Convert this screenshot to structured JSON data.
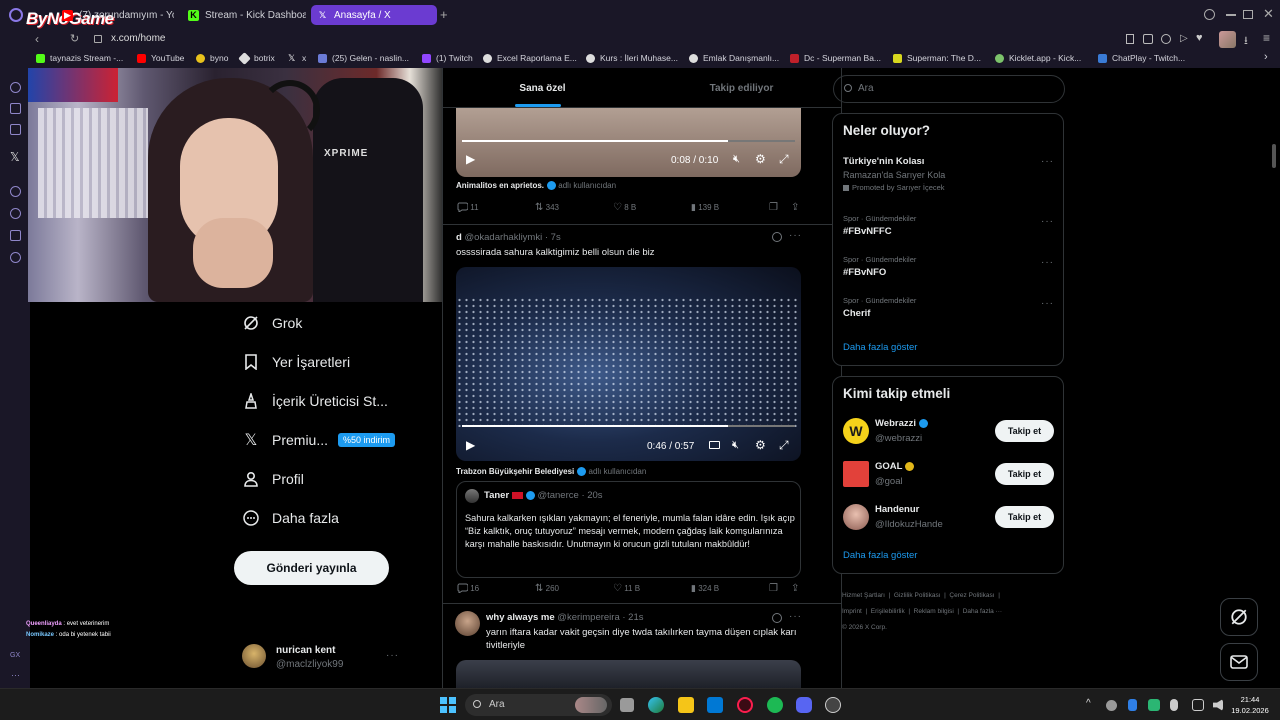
{
  "browser": {
    "logo_text": "ByNoGame",
    "tabs": [
      {
        "label": "(7) zorundamıyım - YouTube"
      },
      {
        "label": "Stream - Kick Dashboard"
      },
      {
        "label": "Anasayfa / X"
      }
    ],
    "new_tab": "+",
    "url": "x.com/home",
    "bookmarks": [
      "taynazis Stream -...",
      "YouTube",
      "byno",
      "botrix",
      "x",
      "(25) Gelen - naslin...",
      "(1) Twitch",
      "Excel Raporlama E...",
      "Kurs : İleri Muhase...",
      "Emlak Danışmanlı...",
      "Dc - Superman Ba...",
      "Superman: The D...",
      "Kicklet.app - Kick...",
      "ChatPlay - Twitch..."
    ],
    "more_bookmarks": "›"
  },
  "stream_overlay": {
    "chair_brand": "XPRIME",
    "chat": [
      {
        "user": "Queenliayda",
        "msg": "evet veterinerim"
      },
      {
        "user": "Nomikaze",
        "msg": "oda bi yetenek tabii"
      }
    ],
    "gx_label": "GX"
  },
  "nav": {
    "items": [
      {
        "label": "Grok"
      },
      {
        "label": "Yer İşaretleri"
      },
      {
        "label": "İçerik Üreticisi St..."
      },
      {
        "label": "Premiu...",
        "badge": "%50 indirim"
      },
      {
        "label": "Profil"
      },
      {
        "label": "Daha fazla"
      }
    ],
    "post_button": "Gönderi yayınla",
    "account": {
      "name": "nurican kent",
      "handle": "@maclzliyok99",
      "more": "···"
    }
  },
  "feed": {
    "tabs": [
      "Sana özel",
      "Takip ediliyor"
    ],
    "post1": {
      "video_time": "0:08 / 0:10",
      "progress": 0.8,
      "attribution_name": "Animalitos en aprietos.",
      "attribution_suffix": "adlı kullanıcıdan",
      "replies": "11",
      "reposts": "343",
      "likes": "8 B",
      "views": "139 B"
    },
    "post2": {
      "name": "d",
      "handle": "@okadarhakliymki",
      "time": "· 7s",
      "text": "ossssirada sahura kalktigimiz belli olsun die biz",
      "video_time": "0:46 / 0:57",
      "progress": 0.8,
      "attribution_name": "Trabzon Büyükşehir Belediyesi",
      "attribution_suffix": "adlı kullanıcıdan",
      "quote": {
        "name": "Taner",
        "handle": "@tanerce",
        "time": "· 20s",
        "text": "Sahura kalkarken ışıkları yakmayın; el feneriyle, mumla falan idâre edin. Işık açıp “Biz kalktık, oruç tutuyoruz” mesajı vermek, modern çağdaş laik komşularınıza karşı mahalle baskısıdır. Unutmayın ki orucun gizli tutulanı makbûldür!"
      },
      "replies": "16",
      "reposts": "260",
      "likes": "11 B",
      "views": "324 B"
    },
    "post3": {
      "name": "why always me",
      "handle": "@kerimpereira",
      "time": "· 21s",
      "text": "yarın iftara kadar vakit geçsin diye twda takılırken tayma düşen cıplak karı tivitleriyle"
    }
  },
  "right": {
    "search_placeholder": "Ara",
    "trends_title": "Neler oluyor?",
    "trends": [
      {
        "context": "",
        "title": "Türkiye'nin Kolası",
        "sub": "Ramazan'da Sarıyer Kola",
        "promo": "Promoted by Sarıyer İçecek"
      },
      {
        "context": "Spor · Gündemdekiler",
        "title": "#FBvNFFC",
        "sub": "",
        "promo": ""
      },
      {
        "context": "Spor · Gündemdekiler",
        "title": "#FBvNFO",
        "sub": "",
        "promo": ""
      },
      {
        "context": "Spor · Gündemdekiler",
        "title": "Cherif",
        "sub": "",
        "promo": ""
      }
    ],
    "trends_more": "Daha fazla göster",
    "who_title": "Kimi takip etmeli",
    "who": [
      {
        "name": "Webrazzi",
        "handle": "@webrazzi",
        "button": "Takip et"
      },
      {
        "name": "GOAL",
        "handle": "@goal",
        "button": "Takip et"
      },
      {
        "name": "Handenur",
        "handle": "@IldokuzHande",
        "button": "Takip et"
      }
    ],
    "who_more": "Daha fazla göster",
    "footer_links": [
      "Hizmet Şartları",
      "Gizlilik Politikası",
      "Çerez Politikası",
      "Imprint",
      "Erişilebilirlik",
      "Reklam bilgisi",
      "Daha fazla ···"
    ],
    "copyright": "© 2026 X Corp."
  },
  "taskbar": {
    "search_placeholder": "Ara",
    "time": "21:44",
    "date": "19.02.2026",
    "chevron": "^"
  }
}
